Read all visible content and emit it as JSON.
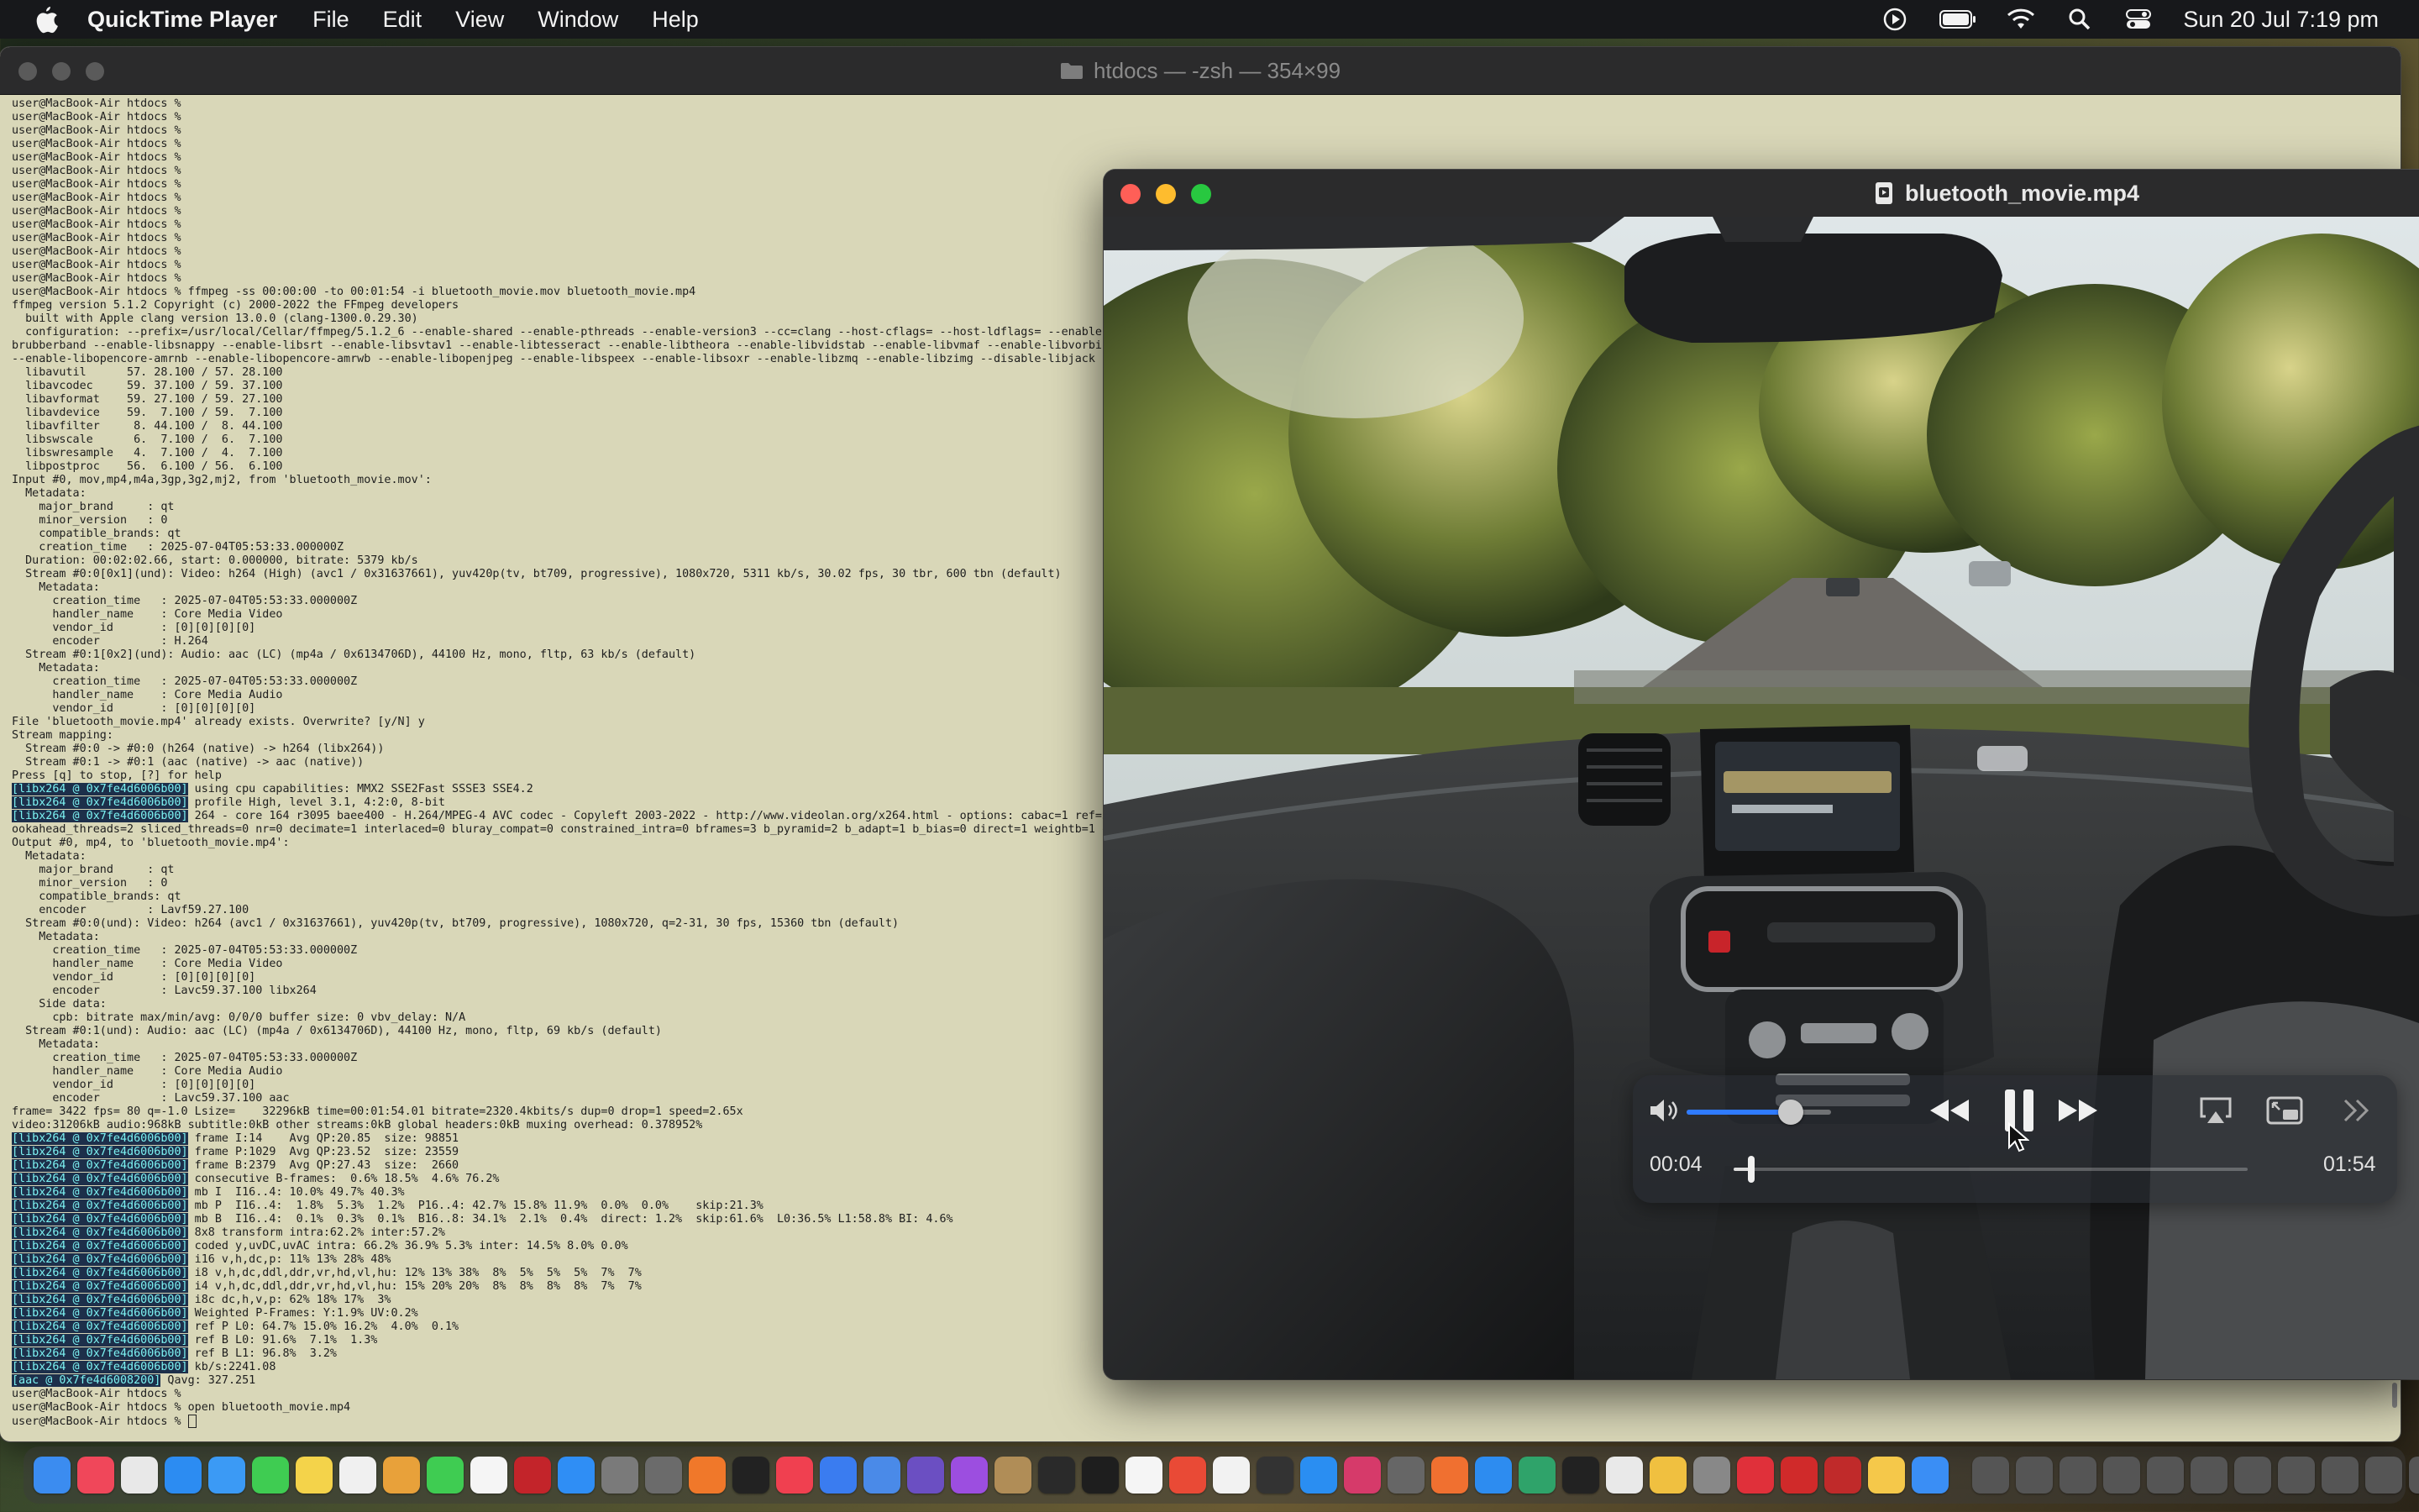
{
  "menubar": {
    "app_name": "QuickTime Player",
    "items": [
      "File",
      "Edit",
      "View",
      "Window",
      "Help"
    ],
    "clock": "Sun 20 Jul  7:19 pm"
  },
  "terminal": {
    "title": "htdocs — -zsh — 354×99",
    "lines": [
      {
        "t": "user@MacBook-Air htdocs %"
      },
      {
        "t": "user@MacBook-Air htdocs %"
      },
      {
        "t": "user@MacBook-Air htdocs %"
      },
      {
        "t": "user@MacBook-Air htdocs %"
      },
      {
        "t": "user@MacBook-Air htdocs %"
      },
      {
        "t": "user@MacBook-Air htdocs %"
      },
      {
        "t": "user@MacBook-Air htdocs %"
      },
      {
        "t": "user@MacBook-Air htdocs %"
      },
      {
        "t": "user@MacBook-Air htdocs %"
      },
      {
        "t": "user@MacBook-Air htdocs %"
      },
      {
        "t": "user@MacBook-Air htdocs %"
      },
      {
        "t": "user@MacBook-Air htdocs %"
      },
      {
        "t": "user@MacBook-Air htdocs %"
      },
      {
        "t": "user@MacBook-Air htdocs %"
      },
      {
        "t": "user@MacBook-Air htdocs % ffmpeg -ss 00:00:00 -to 00:01:54 -i bluetooth_movie.mov bluetooth_movie.mp4"
      },
      {
        "t": "ffmpeg version 5.1.2 Copyright (c) 2000-2022 the FFmpeg developers"
      },
      {
        "t": "  built with Apple clang version 13.0.0 (clang-1300.0.29.30)"
      },
      {
        "t": "  configuration: --prefix=/usr/local/Cellar/ffmpeg/5.1.2_6 --enable-shared --enable-pthreads --enable-version3 --cc=clang --host-cflags= --host-ldflags= --enable-"
      },
      {
        "t": "brubberband --enable-libsnappy --enable-libsrt --enable-libsvtav1 --enable-libtesseract --enable-libtheora --enable-libvidstab --enable-libvmaf --enable-libvorbis"
      },
      {
        "t": "--enable-libopencore-amrnb --enable-libopencore-amrwb --enable-libopenjpeg --enable-libspeex --enable-libsoxr --enable-libzmq --enable-libzimg --disable-libjack -"
      },
      {
        "t": "  libavutil      57. 28.100 / 57. 28.100"
      },
      {
        "t": "  libavcodec     59. 37.100 / 59. 37.100"
      },
      {
        "t": "  libavformat    59. 27.100 / 59. 27.100"
      },
      {
        "t": "  libavdevice    59.  7.100 / 59.  7.100"
      },
      {
        "t": "  libavfilter     8. 44.100 /  8. 44.100"
      },
      {
        "t": "  libswscale      6.  7.100 /  6.  7.100"
      },
      {
        "t": "  libswresample   4.  7.100 /  4.  7.100"
      },
      {
        "t": "  libpostproc    56.  6.100 / 56.  6.100"
      },
      {
        "t": "Input #0, mov,mp4,m4a,3gp,3g2,mj2, from 'bluetooth_movie.mov':"
      },
      {
        "t": "  Metadata:"
      },
      {
        "t": "    major_brand     : qt"
      },
      {
        "t": "    minor_version   : 0"
      },
      {
        "t": "    compatible_brands: qt"
      },
      {
        "t": "    creation_time   : 2025-07-04T05:53:33.000000Z"
      },
      {
        "t": "  Duration: 00:02:02.66, start: 0.000000, bitrate: 5379 kb/s"
      },
      {
        "t": "  Stream #0:0[0x1](und): Video: h264 (High) (avc1 / 0x31637661), yuv420p(tv, bt709, progressive), 1080x720, 5311 kb/s, 30.02 fps, 30 tbr, 600 tbn (default)"
      },
      {
        "t": "    Metadata:"
      },
      {
        "t": "      creation_time   : 2025-07-04T05:53:33.000000Z"
      },
      {
        "t": "      handler_name    : Core Media Video"
      },
      {
        "t": "      vendor_id       : [0][0][0][0]"
      },
      {
        "t": "      encoder         : H.264"
      },
      {
        "t": "  Stream #0:1[0x2](und): Audio: aac (LC) (mp4a / 0x6134706D), 44100 Hz, mono, fltp, 63 kb/s (default)"
      },
      {
        "t": "    Metadata:"
      },
      {
        "t": "      creation_time   : 2025-07-04T05:53:33.000000Z"
      },
      {
        "t": "      handler_name    : Core Media Audio"
      },
      {
        "t": "      vendor_id       : [0][0][0][0]"
      },
      {
        "t": "File 'bluetooth_movie.mp4' already exists. Overwrite? [y/N] y"
      },
      {
        "t": "Stream mapping:"
      },
      {
        "t": "  Stream #0:0 -> #0:0 (h264 (native) -> h264 (libx264))"
      },
      {
        "t": "  Stream #0:1 -> #0:1 (aac (native) -> aac (native))"
      },
      {
        "t": "Press [q] to stop, [?] for help"
      },
      {
        "tag": "[libx264 @ 0x7fe4d6006b00]",
        "t": " using cpu capabilities: MMX2 SSE2Fast SSSE3 SSE4.2"
      },
      {
        "tag": "[libx264 @ 0x7fe4d6006b00]",
        "t": " profile High, level 3.1, 4:2:0, 8-bit"
      },
      {
        "tag": "[libx264 @ 0x7fe4d6006b00]",
        "t": " 264 - core 164 r3095 baee400 - H.264/MPEG-4 AVC codec - Copyleft 2003-2022 - http://www.videolan.org/x264.html - options: cabac=1 ref=3"
      },
      {
        "t": "ookahead_threads=2 sliced_threads=0 nr=0 decimate=1 interlaced=0 bluray_compat=0 constrained_intra=0 bframes=3 b_pyramid=2 b_adapt=1 b_bias=0 direct=1 weightb=1 o"
      },
      {
        "t": "Output #0, mp4, to 'bluetooth_movie.mp4':"
      },
      {
        "t": "  Metadata:"
      },
      {
        "t": "    major_brand     : qt"
      },
      {
        "t": "    minor_version   : 0"
      },
      {
        "t": "    compatible_brands: qt"
      },
      {
        "t": "    encoder         : Lavf59.27.100"
      },
      {
        "t": "  Stream #0:0(und): Video: h264 (avc1 / 0x31637661), yuv420p(tv, bt709, progressive), 1080x720, q=2-31, 30 fps, 15360 tbn (default)"
      },
      {
        "t": "    Metadata:"
      },
      {
        "t": "      creation_time   : 2025-07-04T05:53:33.000000Z"
      },
      {
        "t": "      handler_name    : Core Media Video"
      },
      {
        "t": "      vendor_id       : [0][0][0][0]"
      },
      {
        "t": "      encoder         : Lavc59.37.100 libx264"
      },
      {
        "t": "    Side data:"
      },
      {
        "t": "      cpb: bitrate max/min/avg: 0/0/0 buffer size: 0 vbv_delay: N/A"
      },
      {
        "t": "  Stream #0:1(und): Audio: aac (LC) (mp4a / 0x6134706D), 44100 Hz, mono, fltp, 69 kb/s (default)"
      },
      {
        "t": "    Metadata:"
      },
      {
        "t": "      creation_time   : 2025-07-04T05:53:33.000000Z"
      },
      {
        "t": "      handler_name    : Core Media Audio"
      },
      {
        "t": "      vendor_id       : [0][0][0][0]"
      },
      {
        "t": "      encoder         : Lavc59.37.100 aac"
      },
      {
        "t": "frame= 3422 fps= 80 q=-1.0 Lsize=    32296kB time=00:01:54.01 bitrate=2320.4kbits/s dup=0 drop=1 speed=2.65x"
      },
      {
        "t": "video:31206kB audio:968kB subtitle:0kB other streams:0kB global headers:0kB muxing overhead: 0.378952%"
      },
      {
        "tag": "[libx264 @ 0x7fe4d6006b00]",
        "t": " frame I:14    Avg QP:20.85  size: 98851"
      },
      {
        "tag": "[libx264 @ 0x7fe4d6006b00]",
        "t": " frame P:1029  Avg QP:23.52  size: 23559"
      },
      {
        "tag": "[libx264 @ 0x7fe4d6006b00]",
        "t": " frame B:2379  Avg QP:27.43  size:  2660"
      },
      {
        "tag": "[libx264 @ 0x7fe4d6006b00]",
        "t": " consecutive B-frames:  0.6% 18.5%  4.6% 76.2%"
      },
      {
        "tag": "[libx264 @ 0x7fe4d6006b00]",
        "t": " mb I  I16..4: 10.0% 49.7% 40.3%"
      },
      {
        "tag": "[libx264 @ 0x7fe4d6006b00]",
        "t": " mb P  I16..4:  1.8%  5.3%  1.2%  P16..4: 42.7% 15.8% 11.9%  0.0%  0.0%    skip:21.3%"
      },
      {
        "tag": "[libx264 @ 0x7fe4d6006b00]",
        "t": " mb B  I16..4:  0.1%  0.3%  0.1%  B16..8: 34.1%  2.1%  0.4%  direct: 1.2%  skip:61.6%  L0:36.5% L1:58.8% BI: 4.6%"
      },
      {
        "tag": "[libx264 @ 0x7fe4d6006b00]",
        "t": " 8x8 transform intra:62.2% inter:57.2%"
      },
      {
        "tag": "[libx264 @ 0x7fe4d6006b00]",
        "t": " coded y,uvDC,uvAC intra: 66.2% 36.9% 5.3% inter: 14.5% 8.0% 0.0%"
      },
      {
        "tag": "[libx264 @ 0x7fe4d6006b00]",
        "t": " i16 v,h,dc,p: 11% 13% 28% 48%"
      },
      {
        "tag": "[libx264 @ 0x7fe4d6006b00]",
        "t": " i8 v,h,dc,ddl,ddr,vr,hd,vl,hu: 12% 13% 38%  8%  5%  5%  5%  7%  7%"
      },
      {
        "tag": "[libx264 @ 0x7fe4d6006b00]",
        "t": " i4 v,h,dc,ddl,ddr,vr,hd,vl,hu: 15% 20% 20%  8%  8%  8%  8%  7%  7%"
      },
      {
        "tag": "[libx264 @ 0x7fe4d6006b00]",
        "t": " i8c dc,h,v,p: 62% 18% 17%  3%"
      },
      {
        "tag": "[libx264 @ 0x7fe4d6006b00]",
        "t": " Weighted P-Frames: Y:1.9% UV:0.2%"
      },
      {
        "tag": "[libx264 @ 0x7fe4d6006b00]",
        "t": " ref P L0: 64.7% 15.0% 16.2%  4.0%  0.1%"
      },
      {
        "tag": "[libx264 @ 0x7fe4d6006b00]",
        "t": " ref B L0: 91.6%  7.1%  1.3%"
      },
      {
        "tag": "[libx264 @ 0x7fe4d6006b00]",
        "t": " ref B L1: 96.8%  3.2%"
      },
      {
        "tag": "[libx264 @ 0x7fe4d6006b00]",
        "t": " kb/s:2241.08"
      },
      {
        "tag": "[aac @ 0x7fe4d6008200]",
        "t": " Qavg: 327.251"
      },
      {
        "t": "user@MacBook-Air htdocs %"
      },
      {
        "t": "user@MacBook-Air htdocs % open bluetooth_movie.mp4"
      },
      {
        "t": "user@MacBook-Air htdocs % ",
        "cursor": true
      }
    ]
  },
  "player": {
    "title": "bluetooth_movie.mp4",
    "elapsed": "00:04",
    "duration": "01:54",
    "progress_fraction": 0.035,
    "volume_fraction": 0.72,
    "state": "playing"
  },
  "colors": {
    "accent": "#2f7bff",
    "close": "#ff5f57",
    "minimize": "#febc2e",
    "zoom": "#28c840"
  },
  "dock": {
    "icons": [
      "finder-icon",
      "music-icon",
      "launchpad-icon",
      "safari-icon",
      "mail-icon",
      "messages-icon",
      "notes-icon",
      "freeform-icon",
      "photos-icon",
      "facetime-icon",
      "textedit-icon",
      "filezilla-icon",
      "app-store-icon",
      "calculator-icon",
      "utility-icon",
      "firefox-icon",
      "apple-tv-icon",
      "news-icon",
      "no-entry-icon",
      "preview-icon",
      "bbedit-icon",
      "podcasts-icon",
      "archive-icon",
      "terminal-icon",
      "terminal-alt-icon",
      "calendar-icon",
      "chrome-icon",
      "document-icon",
      "console-icon",
      "quicktime-icon",
      "intellij-icon",
      "dashboard-icon",
      "settings-icon",
      "zoom-icon",
      "affinity-icon",
      "github-icon",
      "chatgpt-icon",
      "pencil-icon",
      "monkey-icon",
      "opera-icon",
      "antivirus-icon",
      "filemerge-icon",
      "lightbulb-icon",
      "xcode-icon",
      "window-thumb-icon",
      "window-thumb-icon",
      "window-thumb-icon",
      "window-thumb-icon",
      "window-thumb-icon",
      "window-thumb-icon",
      "window-thumb-icon",
      "window-thumb-icon",
      "window-thumb-icon",
      "window-thumb-icon",
      "window-thumb-icon",
      "trash-icon"
    ]
  }
}
